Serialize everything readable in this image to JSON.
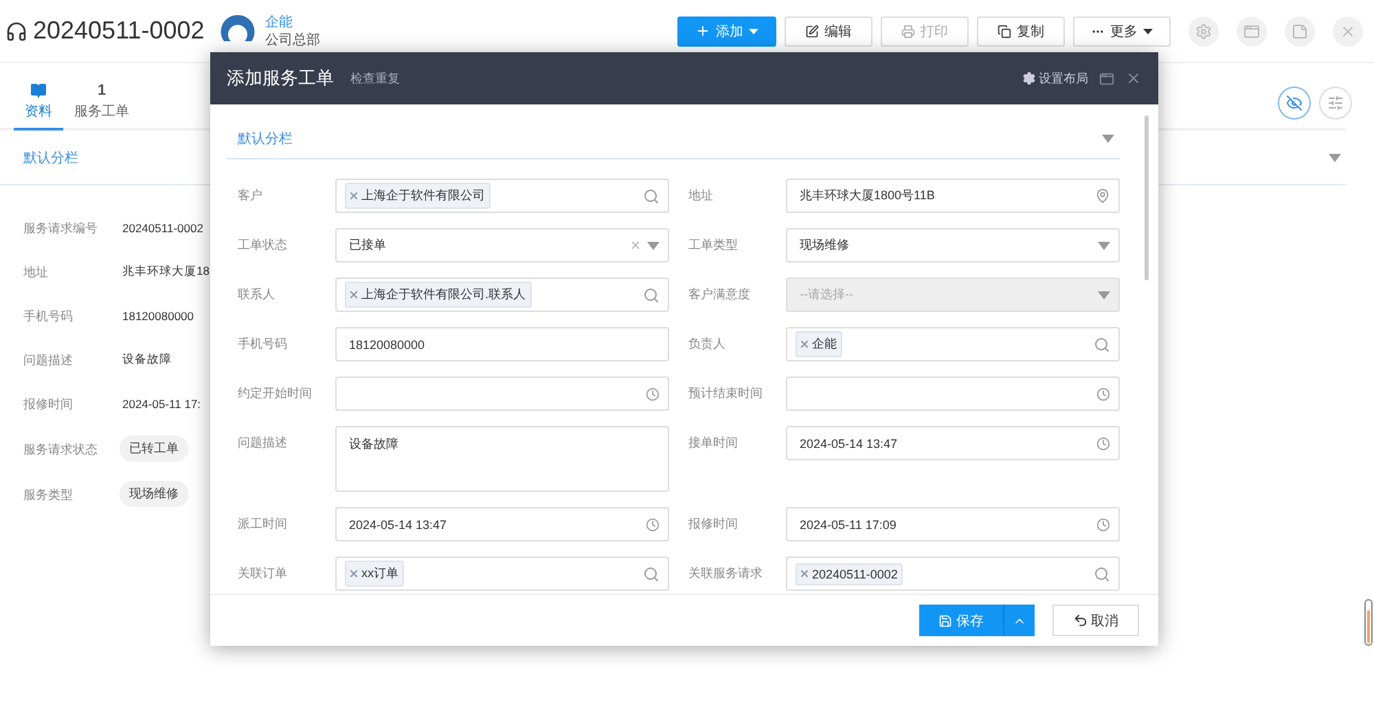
{
  "header": {
    "title": "20240511-0002",
    "user": {
      "name": "企能",
      "org": "公司总部"
    },
    "actions": [
      {
        "label": "添加",
        "kind": "primary",
        "caret": true,
        "disabled": false
      },
      {
        "label": "编辑",
        "kind": "default",
        "caret": false,
        "disabled": false
      },
      {
        "label": "打印",
        "kind": "default",
        "caret": false,
        "disabled": true
      },
      {
        "label": "复制",
        "kind": "default",
        "caret": false,
        "disabled": false
      },
      {
        "label": "更多",
        "kind": "default",
        "caret": true,
        "disabled": false
      }
    ]
  },
  "tabs": [
    {
      "label": "资料",
      "selected": true
    },
    {
      "count": "1",
      "label": "服务工单",
      "selected": false
    }
  ],
  "section": {
    "title": "默认分栏"
  },
  "details": [
    {
      "label": "服务请求编号",
      "value": "20240511-0002",
      "kind": "text"
    },
    {
      "label": "地址",
      "value": "兆丰环球大厦18",
      "kind": "text"
    },
    {
      "label": "手机号码",
      "value": "18120080000",
      "kind": "text"
    },
    {
      "label": "问题描述",
      "value": "设备故障",
      "kind": "text"
    },
    {
      "label": "报修时间",
      "value": "2024-05-11 17:",
      "kind": "text"
    },
    {
      "label": "服务请求状态",
      "value": "已转工单",
      "kind": "tag"
    },
    {
      "label": "服务类型",
      "value": "现场维修",
      "kind": "tag"
    }
  ],
  "dialog": {
    "title": "添加服务工单",
    "subtitle": "检查重复",
    "layout_button": "设置布局",
    "section": "默认分栏",
    "fields": [
      {
        "label": "客户",
        "kind": "tags",
        "tags": [
          "上海企于软件有限公司"
        ],
        "disabled": false
      },
      {
        "label": "地址",
        "kind": "address",
        "value": "兆丰环球大厦1800号11B",
        "disabled": false
      },
      {
        "label": "工单状态",
        "kind": "select",
        "value": "已接单",
        "clearable": true,
        "disabled": false
      },
      {
        "label": "工单类型",
        "kind": "select",
        "value": "现场维修",
        "clearable": false,
        "disabled": false
      },
      {
        "label": "联系人",
        "kind": "tags",
        "tags": [
          "上海企于软件有限公司.联系人"
        ],
        "disabled": false
      },
      {
        "label": "客户满意度",
        "kind": "select",
        "placeholder": "--请选择--",
        "clearable": false,
        "disabled": true
      },
      {
        "label": "手机号码",
        "kind": "text",
        "value": "18120080000",
        "disabled": false
      },
      {
        "label": "负责人",
        "kind": "tags",
        "tags": [
          "企能"
        ],
        "disabled": false
      },
      {
        "label": "约定开始时间",
        "kind": "datetime",
        "disabled": false
      },
      {
        "label": "预计结束时间",
        "kind": "datetime",
        "disabled": false
      },
      {
        "label": "问题描述",
        "kind": "textarea",
        "value": "设备故障",
        "disabled": false
      },
      {
        "label": "接单时间",
        "kind": "datetime",
        "value": "2024-05-14 13:47",
        "disabled": false
      },
      {
        "label": "派工时间",
        "kind": "datetime",
        "value": "2024-05-14 13:47",
        "disabled": false
      },
      {
        "label": "报修时间",
        "kind": "datetime",
        "value": "2024-05-11 17:09",
        "disabled": false
      },
      {
        "label": "关联订单",
        "kind": "tags",
        "tags": [
          "xx订单"
        ],
        "disabled": false
      },
      {
        "label": "关联服务请求",
        "kind": "tags",
        "tags": [
          "20240511-0002"
        ],
        "disabled": false
      }
    ],
    "buttons": [
      {
        "label": "保存",
        "kind": "primary"
      },
      {
        "label": "取消",
        "kind": "default"
      }
    ]
  }
}
